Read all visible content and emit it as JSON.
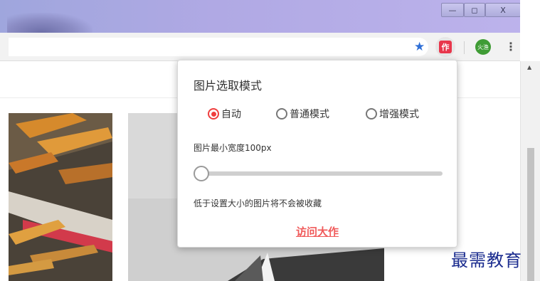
{
  "window": {
    "controls": {
      "minimize": "—",
      "maximize": "◻",
      "close": "X"
    }
  },
  "toolbar": {
    "star_icon": "star-icon",
    "extension_badge": "作",
    "avatar_text": "火渔"
  },
  "popup": {
    "title": "图片选取模式",
    "modes": [
      {
        "label": "自动",
        "selected": true
      },
      {
        "label": "普通模式",
        "selected": false
      },
      {
        "label": "增强模式",
        "selected": false
      }
    ],
    "min_width_label": "图片最小宽度100px",
    "slider_value": 0,
    "note": "低于设置大小的图片将不会被收藏",
    "visit_link": "访问大作"
  },
  "watermark": "最需教育",
  "colors": {
    "accent": "#ef3e3e",
    "link": "#f05a5a",
    "star": "#2f6fd6",
    "watermark": "#1b2c8f"
  }
}
